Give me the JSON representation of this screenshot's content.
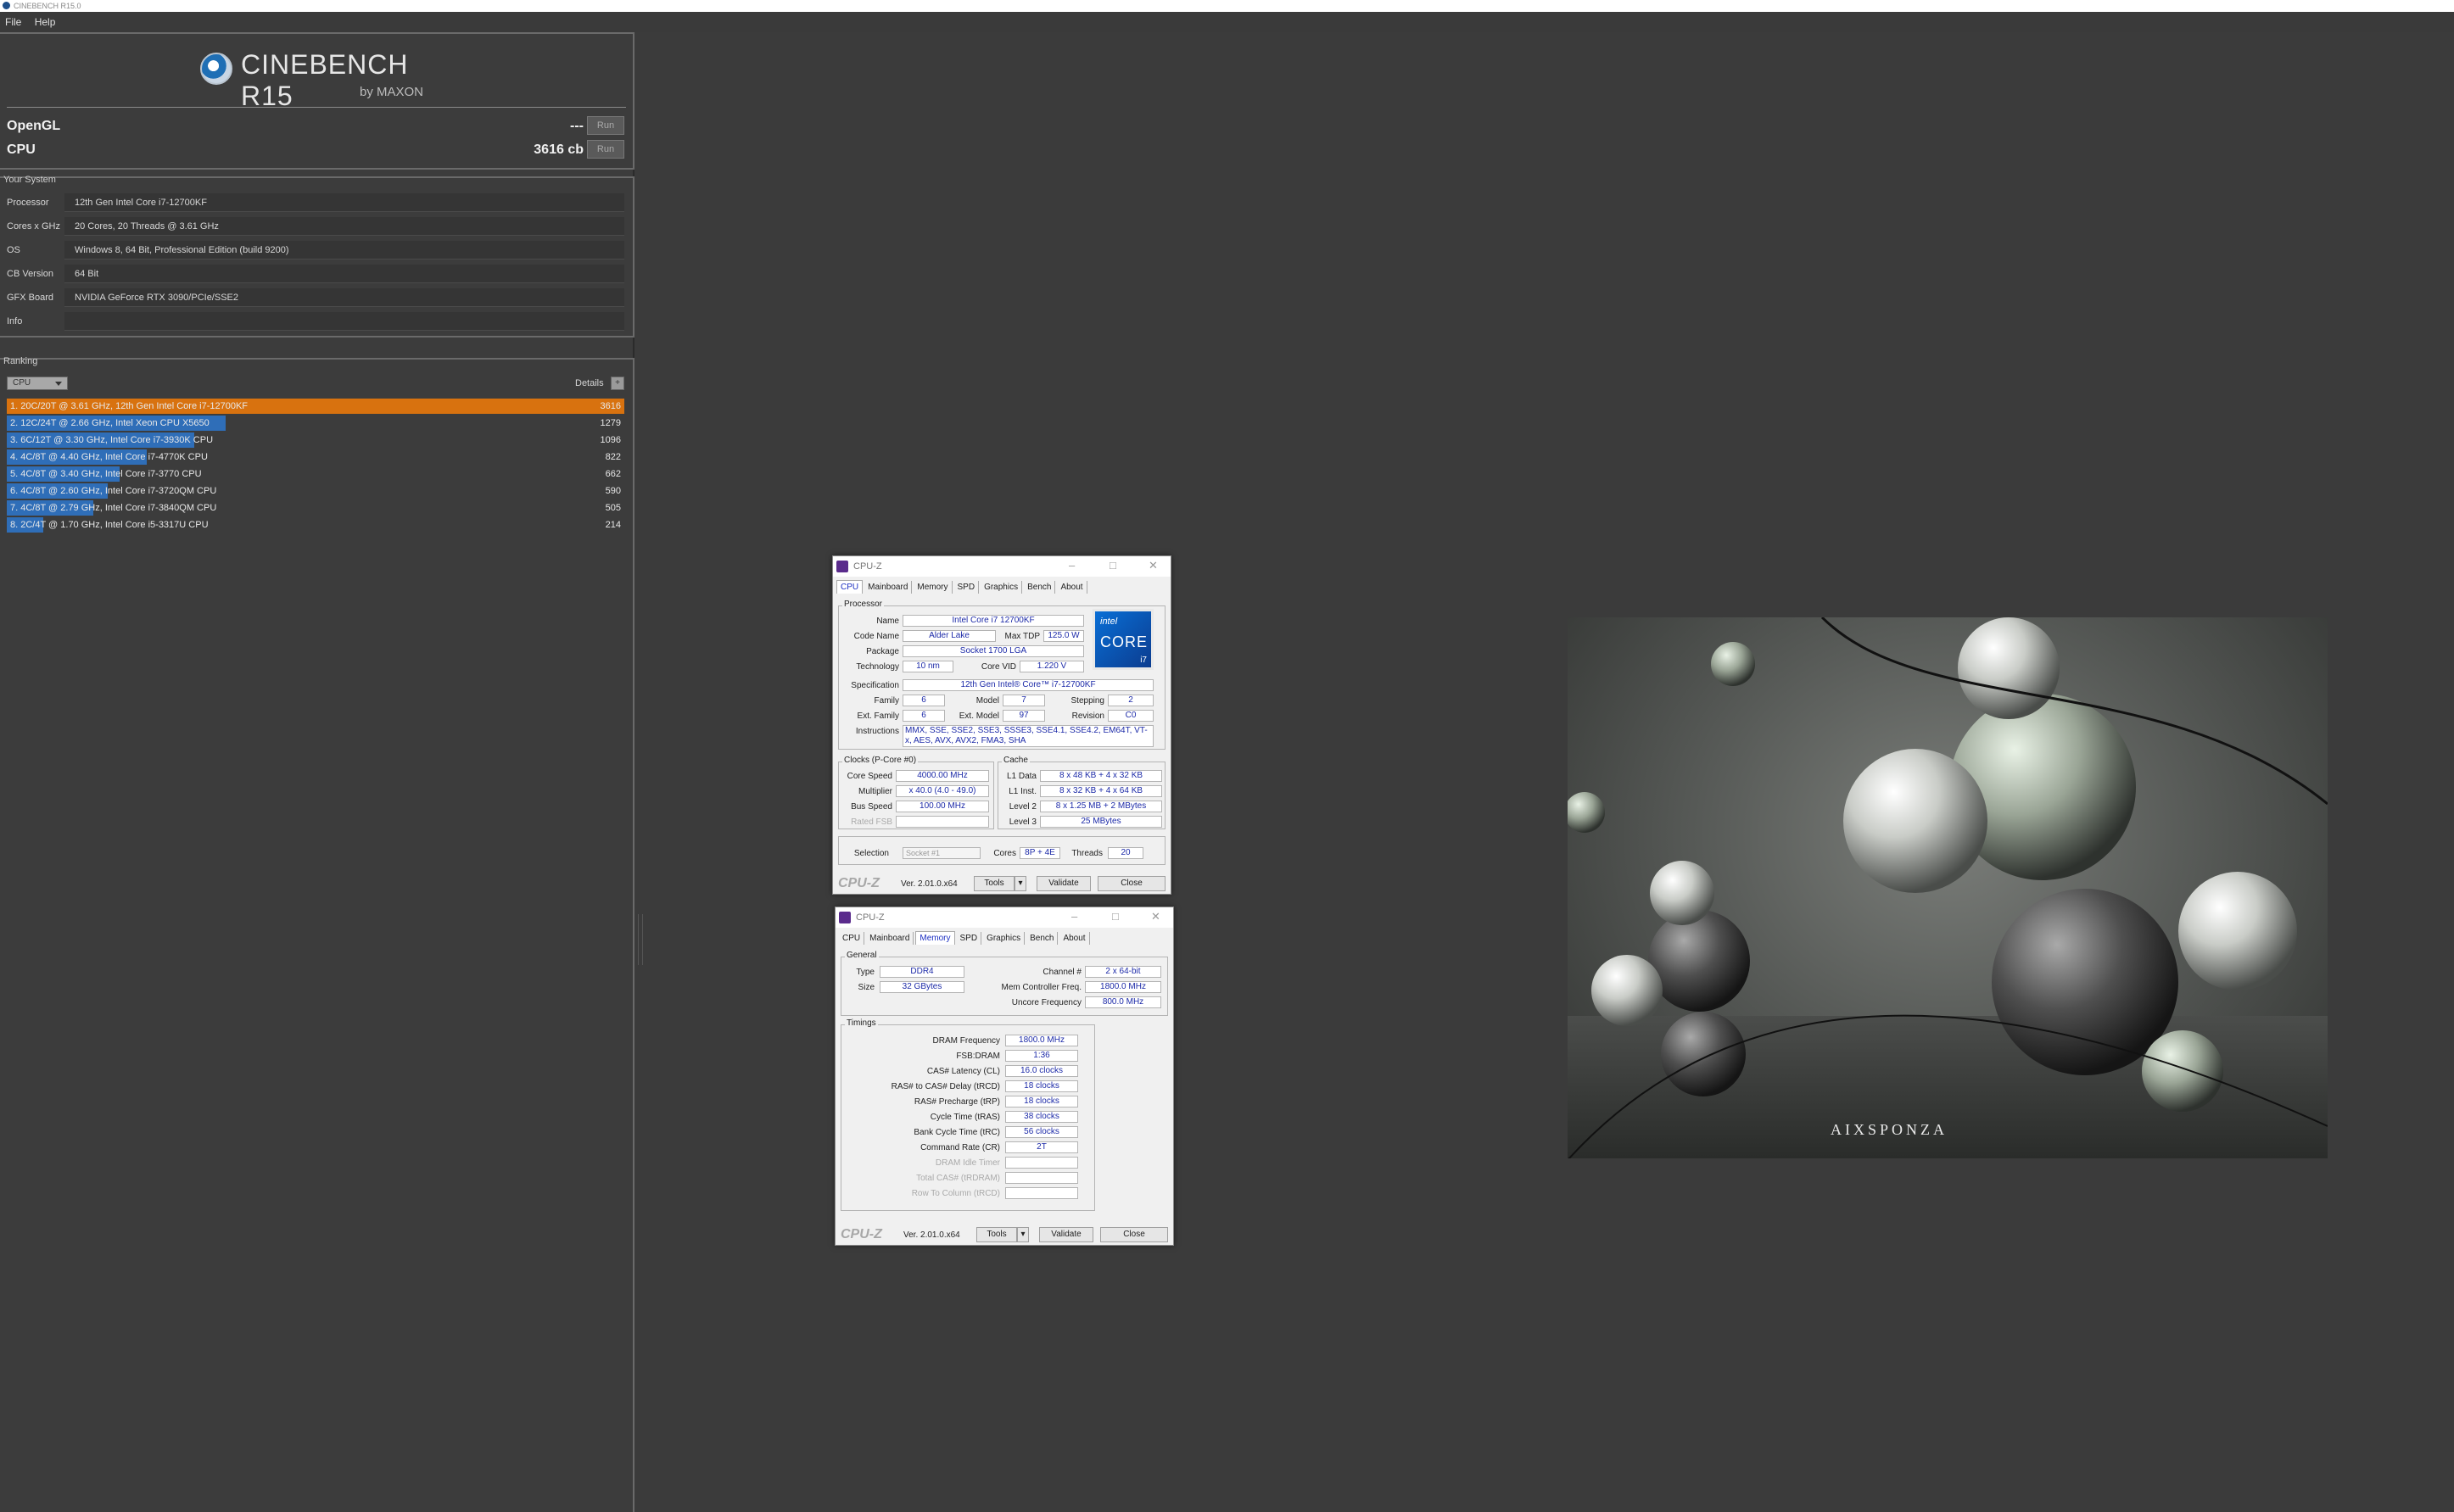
{
  "window": {
    "title": "CINEBENCH R15.0"
  },
  "menu": [
    "File",
    "Help"
  ],
  "cinebench": {
    "title": "CINEBENCH R15",
    "subtitle": "by MAXON",
    "scores": [
      {
        "label": "OpenGL",
        "value": "---",
        "button": "Run"
      },
      {
        "label": "CPU",
        "value": "3616 cb",
        "button": "Run"
      }
    ]
  },
  "system": {
    "section": "Your System",
    "rows": [
      {
        "key": "Processor",
        "value": "12th Gen Intel Core i7-12700KF"
      },
      {
        "key": "Cores x GHz",
        "value": "20 Cores, 20 Threads @ 3.61 GHz"
      },
      {
        "key": "OS",
        "value": "Windows 8, 64 Bit, Professional Edition (build 9200)"
      },
      {
        "key": "CB Version",
        "value": "64 Bit"
      },
      {
        "key": "GFX Board",
        "value": "NVIDIA GeForce RTX 3090/PCIe/SSE2"
      },
      {
        "key": "Info",
        "value": ""
      }
    ]
  },
  "ranking": {
    "section": "Ranking",
    "dropdown": "CPU",
    "details_label": "Details",
    "details_button": "+",
    "colors": {
      "mine": "#d8720f",
      "others": "#2f6eb8"
    },
    "rows": [
      {
        "text": "1. 20C/20T @ 3.61 GHz, 12th Gen Intel Core i7-12700KF",
        "score": 3616,
        "bar_fraction": 1.0,
        "mine": true
      },
      {
        "text": "2. 12C/24T @ 2.66 GHz, Intel Xeon CPU X5650",
        "score": 1279,
        "bar_fraction": 0.354,
        "mine": false
      },
      {
        "text": "3. 6C/12T @ 3.30 GHz,  Intel Core i7-3930K CPU",
        "score": 1096,
        "bar_fraction": 0.303,
        "mine": false
      },
      {
        "text": "4. 4C/8T @ 4.40 GHz, Intel Core i7-4770K CPU",
        "score": 822,
        "bar_fraction": 0.227,
        "mine": false
      },
      {
        "text": "5. 4C/8T @ 3.40 GHz,  Intel Core i7-3770 CPU",
        "score": 662,
        "bar_fraction": 0.183,
        "mine": false
      },
      {
        "text": "6. 4C/8T @ 2.60 GHz, Intel Core i7-3720QM CPU",
        "score": 590,
        "bar_fraction": 0.163,
        "mine": false
      },
      {
        "text": "7. 4C/8T @ 2.79 GHz,  Intel Core i7-3840QM CPU",
        "score": 505,
        "bar_fraction": 0.14,
        "mine": false
      },
      {
        "text": "8. 2C/4T @ 1.70 GHz,  Intel Core i5-3317U CPU",
        "score": 214,
        "bar_fraction": 0.059,
        "mine": false
      }
    ]
  },
  "cpuz_cpu": {
    "title": "CPU-Z",
    "tabs": [
      "CPU",
      "Mainboard",
      "Memory",
      "SPD",
      "Graphics",
      "Bench",
      "About"
    ],
    "active_tab": "CPU",
    "processor_label": "Processor",
    "name_label": "Name",
    "name": "Intel Core i7 12700KF",
    "codename_label": "Code Name",
    "codename": "Alder Lake",
    "maxtdp_label": "Max TDP",
    "maxtdp": "125.0 W",
    "package_label": "Package",
    "package": "Socket 1700 LGA",
    "technology_label": "Technology",
    "technology": "10 nm",
    "corevid_label": "Core VID",
    "corevid": "1.220 V",
    "spec_label": "Specification",
    "spec": "12th Gen Intel® Core™ i7-12700KF",
    "family_label": "Family",
    "family": "6",
    "model_label": "Model",
    "model": "7",
    "stepping_label": "Stepping",
    "stepping": "2",
    "extfamily_label": "Ext. Family",
    "extfamily": "6",
    "extmodel_label": "Ext. Model",
    "extmodel": "97",
    "revision_label": "Revision",
    "revision": "C0",
    "instructions_label": "Instructions",
    "instructions": "MMX, SSE, SSE2, SSE3, SSSE3, SSE4.1, SSE4.2, EM64T, VT-x, AES, AVX, AVX2, FMA3, SHA",
    "badge": {
      "brand": "intel",
      "line": "CORE",
      "tier": "i7"
    },
    "clocks_label": "Clocks (P-Core #0)",
    "corespeed_label": "Core Speed",
    "corespeed": "4000.00 MHz",
    "multiplier_label": "Multiplier",
    "multiplier": "x 40.0 (4.0 - 49.0)",
    "busspeed_label": "Bus Speed",
    "busspeed": "100.00 MHz",
    "ratedfsb_label": "Rated FSB",
    "ratedfsb": "",
    "cache_label": "Cache",
    "l1data_label": "L1 Data",
    "l1data": "8 x 48 KB + 4 x 32 KB",
    "l1inst_label": "L1 Inst.",
    "l1inst": "8 x 32 KB + 4 x 64 KB",
    "level2_label": "Level 2",
    "level2": "8 x 1.25 MB + 2 MBytes",
    "level3_label": "Level 3",
    "level3": "25 MBytes",
    "selection_label": "Selection",
    "selection": "Socket #1",
    "cores_label": "Cores",
    "cores": "8P + 4E",
    "threads_label": "Threads",
    "threads": "20",
    "footer": {
      "brand": "CPU-Z",
      "version": "Ver. 2.01.0.x64",
      "tools": "Tools",
      "validate": "Validate",
      "close": "Close"
    }
  },
  "cpuz_mem": {
    "title": "CPU-Z",
    "tabs": [
      "CPU",
      "Mainboard",
      "Memory",
      "SPD",
      "Graphics",
      "Bench",
      "About"
    ],
    "active_tab": "Memory",
    "general_label": "General",
    "type_label": "Type",
    "type": "DDR4",
    "size_label": "Size",
    "size": "32 GBytes",
    "channel_label": "Channel #",
    "channel": "2 x 64-bit",
    "memctrl_label": "Mem Controller Freq.",
    "memctrl": "1800.0 MHz",
    "uncore_label": "Uncore Frequency",
    "uncore": "800.0 MHz",
    "timings_label": "Timings",
    "timings": [
      {
        "label": "DRAM Frequency",
        "value": "1800.0 MHz",
        "disabled": false
      },
      {
        "label": "FSB:DRAM",
        "value": "1:36",
        "disabled": false
      },
      {
        "label": "CAS# Latency (CL)",
        "value": "16.0 clocks",
        "disabled": false
      },
      {
        "label": "RAS# to CAS# Delay (tRCD)",
        "value": "18 clocks",
        "disabled": false
      },
      {
        "label": "RAS# Precharge (tRP)",
        "value": "18 clocks",
        "disabled": false
      },
      {
        "label": "Cycle Time (tRAS)",
        "value": "38 clocks",
        "disabled": false
      },
      {
        "label": "Bank Cycle Time (tRC)",
        "value": "56 clocks",
        "disabled": false
      },
      {
        "label": "Command Rate (CR)",
        "value": "2T",
        "disabled": false
      },
      {
        "label": "DRAM Idle Timer",
        "value": "",
        "disabled": true
      },
      {
        "label": "Total CAS# (tRDRAM)",
        "value": "",
        "disabled": true
      },
      {
        "label": "Row To Column (tRCD)",
        "value": "",
        "disabled": true
      }
    ],
    "footer": {
      "brand": "CPU-Z",
      "version": "Ver. 2.01.0.x64",
      "tools": "Tools",
      "validate": "Validate",
      "close": "Close"
    }
  },
  "render": {
    "watermark": "AIXSPONZA"
  }
}
